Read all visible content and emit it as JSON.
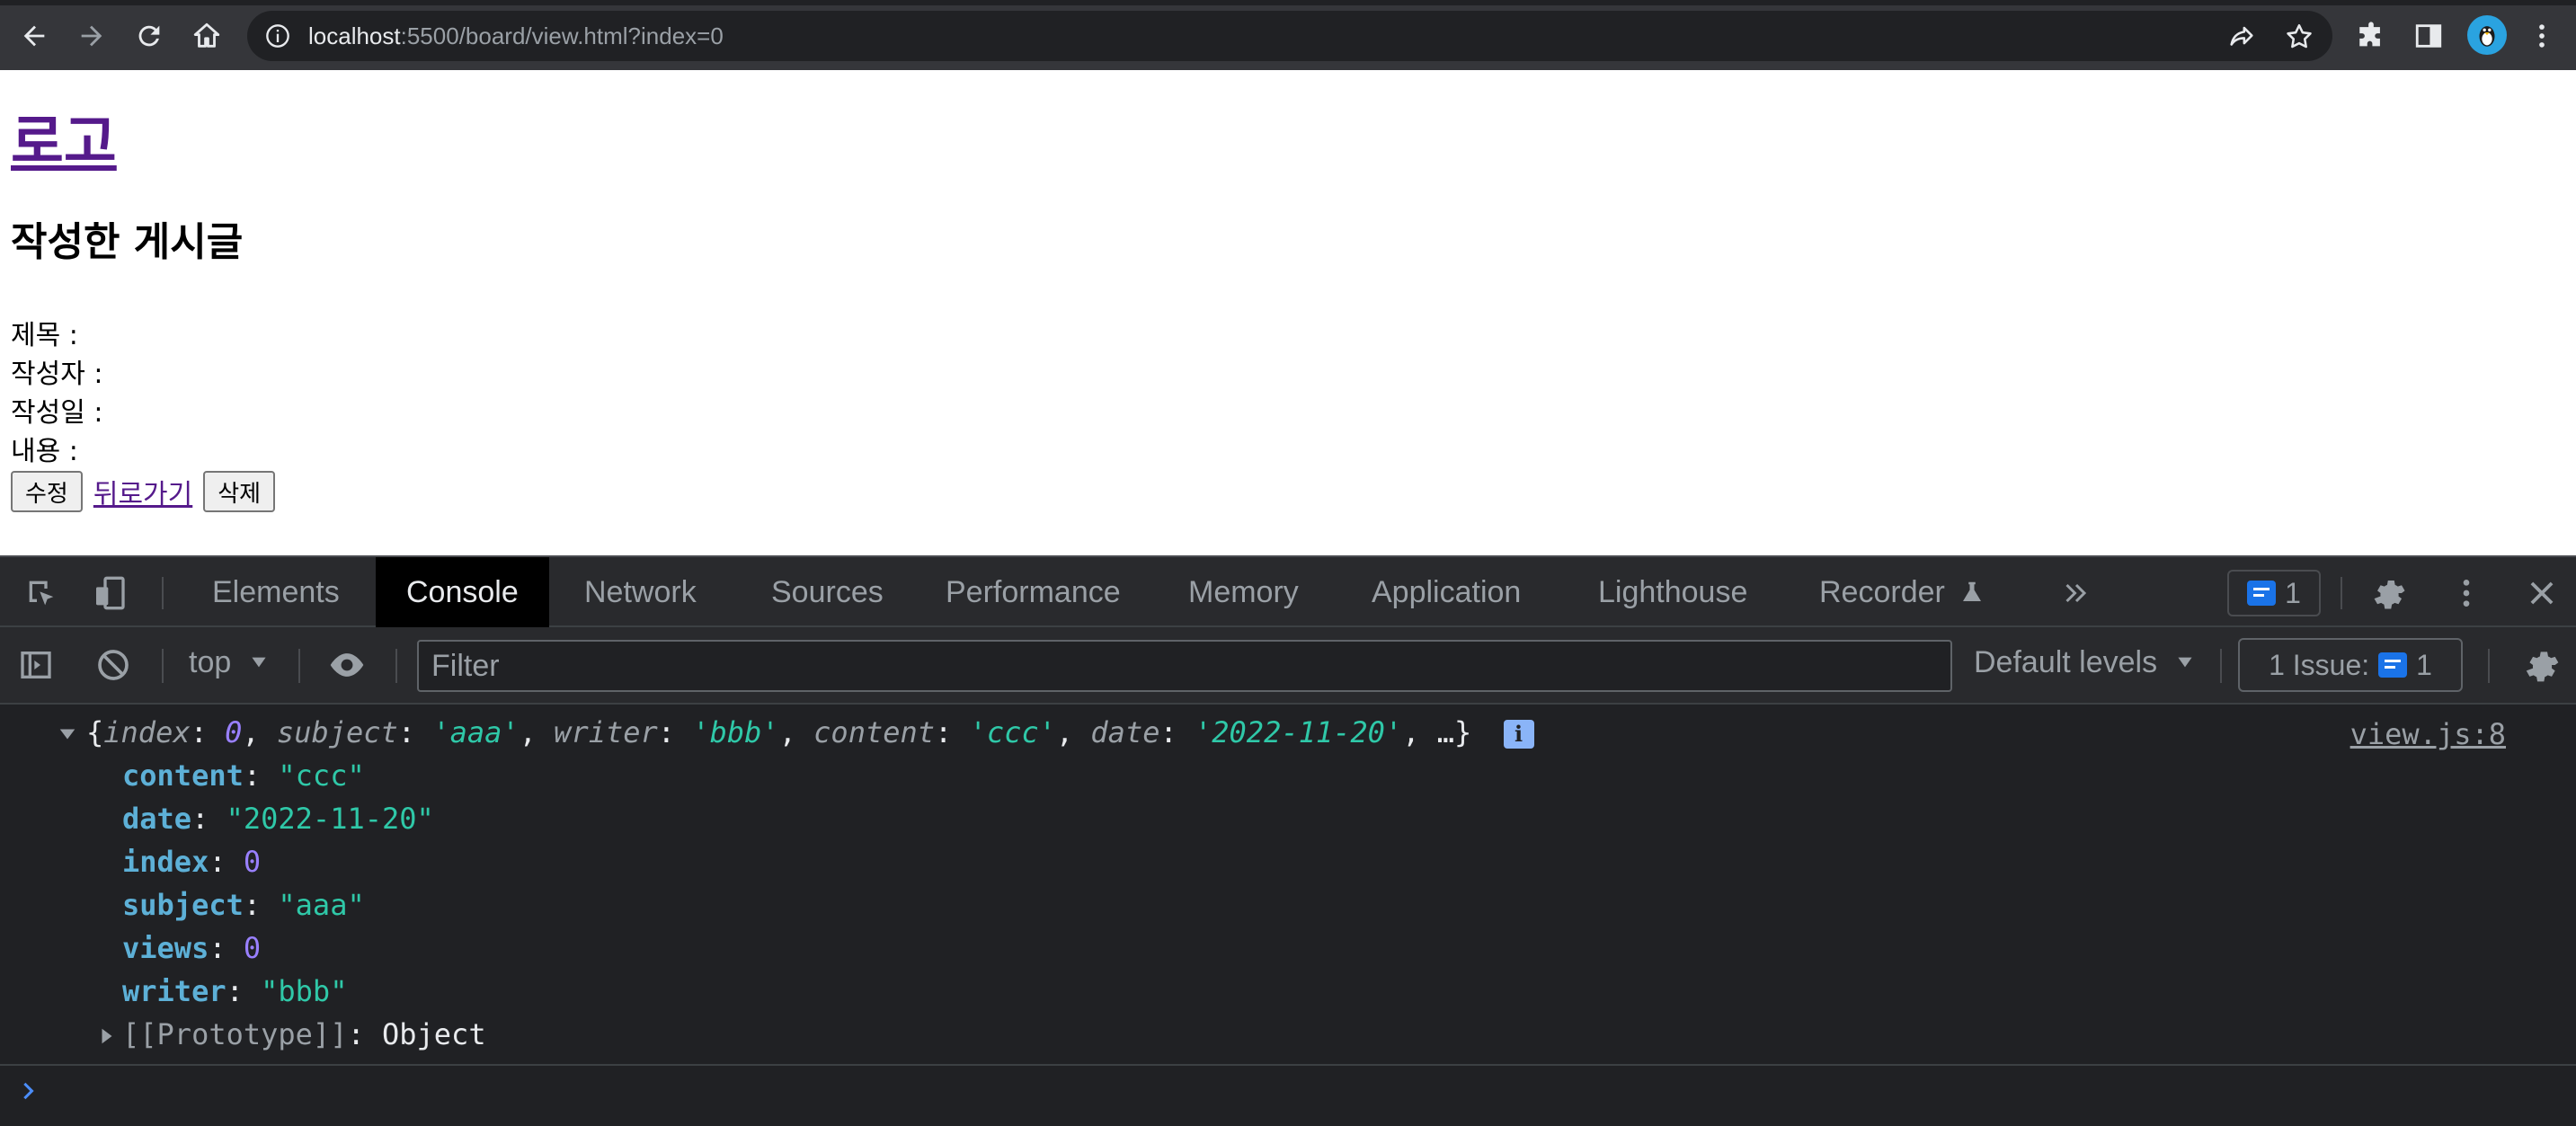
{
  "browser": {
    "url_host": "localhost",
    "url_rest": ":5500/board/view.html?index=0"
  },
  "page": {
    "logo": "로고",
    "heading": "작성한 게시글",
    "fields": [
      {
        "label": "제목 :"
      },
      {
        "label": "작성자 :"
      },
      {
        "label": "작성일 :"
      },
      {
        "label": "내용 :"
      }
    ],
    "edit_button": "수정",
    "back_link": "뒤로가기",
    "delete_button": "삭제"
  },
  "devtools": {
    "tabs": [
      "Elements",
      "Console",
      "Network",
      "Sources",
      "Performance",
      "Memory",
      "Application",
      "Lighthouse",
      "Recorder"
    ],
    "active_tab": "Console",
    "message_count": "1",
    "context": "top",
    "filter_placeholder": "Filter",
    "levels": "Default levels",
    "issues_label": "1 Issue:",
    "issues_count": "1"
  },
  "console": {
    "source": "view.js:8",
    "summary": {
      "index": "0",
      "subject": "'aaa'",
      "writer": "'bbb'",
      "content": "'ccc'",
      "date": "'2022-11-20'",
      "more": "…}"
    },
    "properties": [
      {
        "key": "content",
        "value": "\"ccc\"",
        "type": "str"
      },
      {
        "key": "date",
        "value": "\"2022-11-20\"",
        "type": "str"
      },
      {
        "key": "index",
        "value": "0",
        "type": "num"
      },
      {
        "key": "subject",
        "value": "\"aaa\"",
        "type": "str"
      },
      {
        "key": "views",
        "value": "0",
        "type": "num"
      },
      {
        "key": "writer",
        "value": "\"bbb\"",
        "type": "str"
      }
    ],
    "prototype_label": "[[Prototype]]",
    "prototype_value": "Object"
  },
  "colors": {
    "link": "#551a8b",
    "accent": "#1a73e8",
    "string": "#2fc8a8",
    "number": "#9980ff",
    "key": "#5db0d7"
  }
}
